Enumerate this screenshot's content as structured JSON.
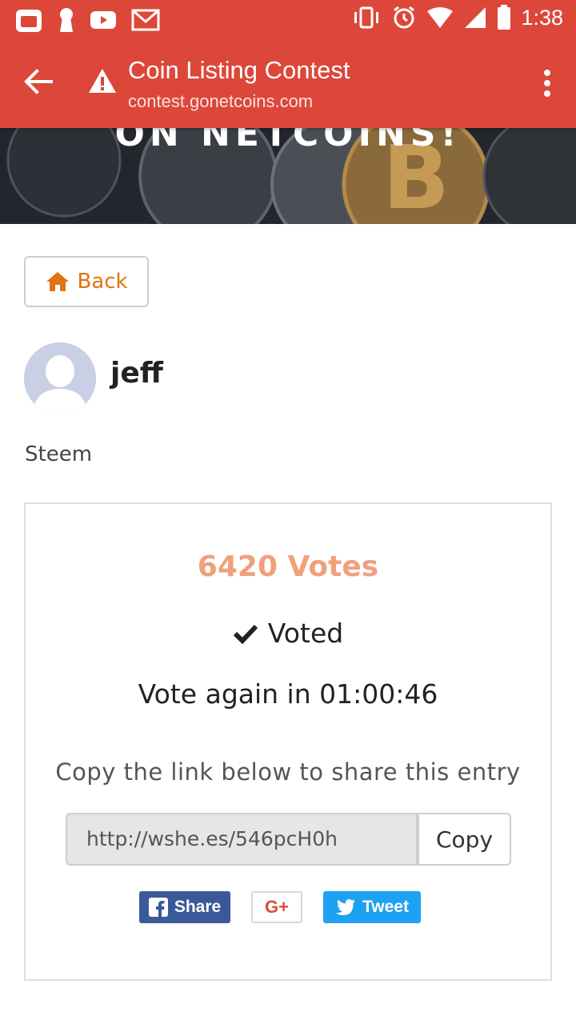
{
  "status_bar": {
    "time": "1:38"
  },
  "app_bar": {
    "title": "Coin Listing Contest",
    "url": "contest.gonetcoins.com"
  },
  "banner": {
    "text": "ON NETCOINS!"
  },
  "entry": {
    "back_label": "Back",
    "username": "jeff",
    "coin_name": "Steem",
    "votes": "6420 Votes",
    "voted_label": "Voted",
    "vote_again": "Vote again in 01:00:46",
    "copy_hint": "Copy the link below to share this entry",
    "share_link": "http://wshe.es/546pcH0h",
    "copy_label": "Copy"
  },
  "share": {
    "facebook_label": "Share",
    "google_label": "G+",
    "twitter_label": "Tweet"
  },
  "colors": {
    "brand_red": "#dc473a",
    "accent_orange": "#e07412",
    "votes_color": "#efa17c",
    "facebook": "#3b5998",
    "twitter": "#1da1f2"
  }
}
